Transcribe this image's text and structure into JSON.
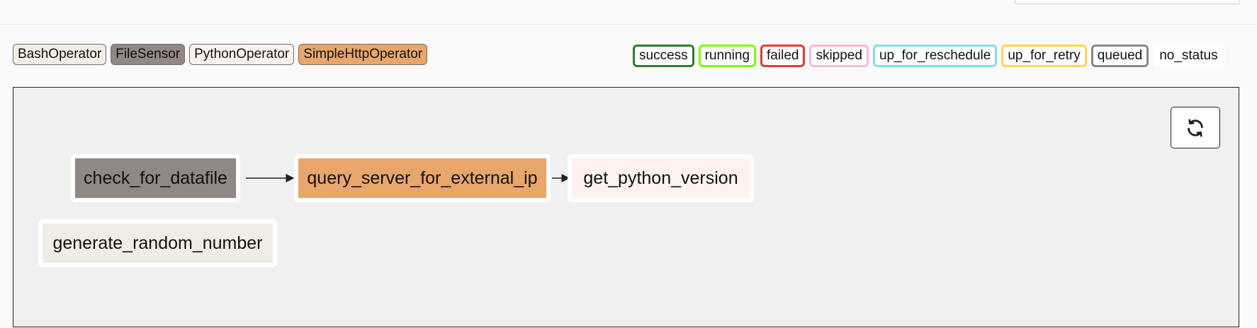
{
  "operator_legend": [
    {
      "label": "BashOperator",
      "color": "#f0ede4"
    },
    {
      "label": "FileSensor",
      "color": "#918785"
    },
    {
      "label": "PythonOperator",
      "color": "#fff2ee"
    },
    {
      "label": "SimpleHttpOperator",
      "color": "#e8a66a"
    }
  ],
  "status_legend": [
    {
      "label": "success",
      "color": "#2e7d32"
    },
    {
      "label": "running",
      "color": "#7cfc00"
    },
    {
      "label": "failed",
      "color": "#e53935"
    },
    {
      "label": "skipped",
      "color": "#f8bbd0"
    },
    {
      "label": "up_for_reschedule",
      "color": "#80deea"
    },
    {
      "label": "up_for_retry",
      "color": "#ffd54f"
    },
    {
      "label": "queued",
      "color": "#888888"
    },
    {
      "label": "no_status",
      "color": "#ffffff"
    }
  ],
  "graph": {
    "refresh_icon": "refresh-icon",
    "tasks": {
      "check_for_datafile": {
        "label": "check_for_datafile",
        "color": "#918785"
      },
      "query_server_for_external_ip": {
        "label": "query_server_for_external_ip",
        "color": "#e8a66a"
      },
      "get_python_version": {
        "label": "get_python_version",
        "color": "#fff2ee"
      },
      "generate_random_number": {
        "label": "generate_random_number",
        "color": "#f0ede4"
      }
    }
  }
}
